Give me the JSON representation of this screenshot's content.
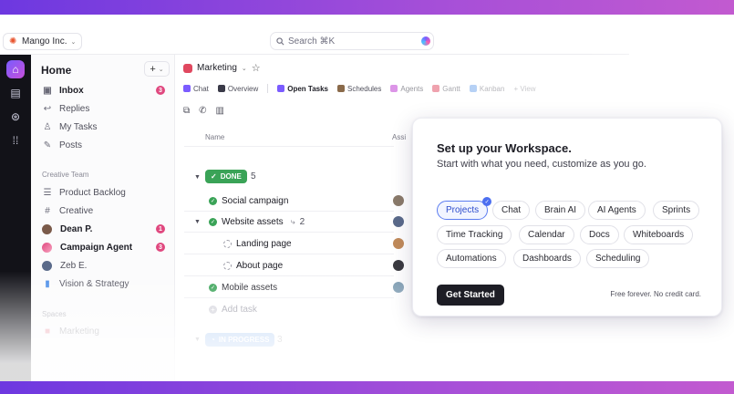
{
  "workspace": {
    "name": "Mango Inc."
  },
  "search": {
    "label": "Search ⌘K"
  },
  "sidebar": {
    "title": "Home",
    "items": [
      {
        "label": "Inbox",
        "badge": "3"
      },
      {
        "label": "Replies"
      },
      {
        "label": "My Tasks"
      },
      {
        "label": "Posts"
      }
    ],
    "section_team": "Creative Team",
    "team_items": [
      {
        "label": "Product Backlog"
      },
      {
        "label": "Creative"
      },
      {
        "label": "Dean P.",
        "badge": "1"
      },
      {
        "label": "Campaign Agent",
        "badge": "3"
      },
      {
        "label": "Zeb E."
      },
      {
        "label": "Vision & Strategy"
      }
    ],
    "section_spaces": "Spaces",
    "space_items": [
      {
        "label": "Marketing"
      }
    ]
  },
  "main": {
    "breadcrumb": "Marketing",
    "views": [
      {
        "label": "Chat"
      },
      {
        "label": "Overview"
      },
      {
        "label": "Open Tasks"
      },
      {
        "label": "Schedules"
      },
      {
        "label": "Agents"
      },
      {
        "label": "Gantt"
      },
      {
        "label": "Kanban"
      },
      {
        "label": "+ View"
      }
    ],
    "col_name": "Name",
    "col_assignee": "Assi",
    "groups": [
      {
        "status": "DONE",
        "count": "5"
      },
      {
        "status": "IN PROGRESS",
        "count": "3"
      }
    ],
    "tasks": [
      {
        "label": "Social campaign"
      },
      {
        "label": "Website assets",
        "subcount": "2"
      },
      {
        "label": "Landing page"
      },
      {
        "label": "About page"
      },
      {
        "label": "Mobile assets"
      },
      {
        "label": "Add task"
      }
    ]
  },
  "setup": {
    "title": "Set up your Workspace.",
    "subtitle": "Start with what you need, customize as you go.",
    "options": [
      "Projects",
      "Chat",
      "Brain AI",
      "AI Agents",
      "Sprints",
      "Time Tracking",
      "Calendar",
      "Docs",
      "Whiteboards",
      "Automations",
      "Dashboards",
      "Scheduling"
    ],
    "selected": "Projects",
    "cta": "Get Started",
    "note": "Free forever. No credit card."
  },
  "colors": {
    "accent": "#5b7cf0",
    "done": "#3aa357",
    "badge": "#e0487f",
    "brand_gradient_start": "#6d38e0",
    "brand_gradient_end": "#c25ad0"
  }
}
